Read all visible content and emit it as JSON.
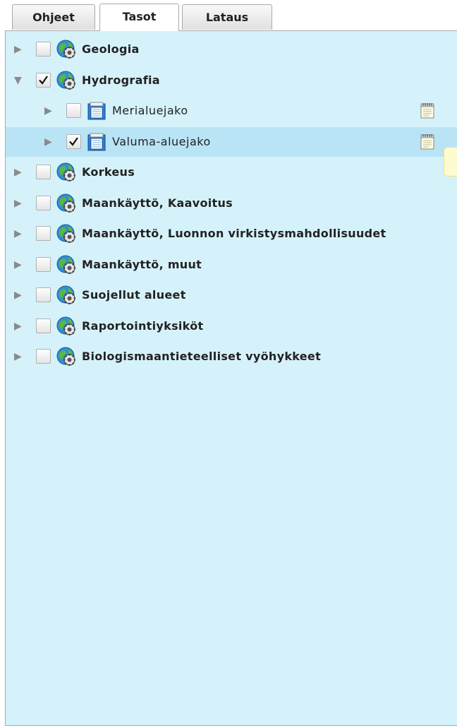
{
  "tabs": [
    {
      "label": "Ohjeet",
      "active": false
    },
    {
      "label": "Tasot",
      "active": true
    },
    {
      "label": "Lataus",
      "active": false
    }
  ],
  "layers": [
    {
      "label": "Geologia",
      "level": 0,
      "checked": false,
      "expanded": false,
      "icon": "globe-gear-icon"
    },
    {
      "label": "Hydrografia",
      "level": 0,
      "checked": true,
      "expanded": true,
      "icon": "globe-gear-icon"
    },
    {
      "label": "Merialuejako",
      "level": 1,
      "checked": false,
      "expanded": false,
      "icon": "folder-layer-icon",
      "has_metadata": true
    },
    {
      "label": "Valuma-aluejako",
      "level": 1,
      "checked": true,
      "expanded": false,
      "icon": "folder-layer-icon",
      "has_metadata": true,
      "selected": true
    },
    {
      "label": "Korkeus",
      "level": 0,
      "checked": false,
      "expanded": false,
      "icon": "globe-gear-icon"
    },
    {
      "label": "Maankäyttö, Kaavoitus",
      "level": 0,
      "checked": false,
      "expanded": false,
      "icon": "globe-gear-icon"
    },
    {
      "label": "Maankäyttö, Luonnon virkistysmahdollisuudet",
      "level": 0,
      "checked": false,
      "expanded": false,
      "icon": "globe-gear-icon"
    },
    {
      "label": "Maankäyttö, muut",
      "level": 0,
      "checked": false,
      "expanded": false,
      "icon": "globe-gear-icon"
    },
    {
      "label": "Suojellut alueet",
      "level": 0,
      "checked": false,
      "expanded": false,
      "icon": "globe-gear-icon"
    },
    {
      "label": "Raportointiyksiköt",
      "level": 0,
      "checked": false,
      "expanded": false,
      "icon": "globe-gear-icon"
    },
    {
      "label": "Biologismaantieteelliset vyöhykkeet",
      "level": 0,
      "checked": false,
      "expanded": false,
      "icon": "globe-gear-icon"
    }
  ],
  "colors": {
    "panel_background": "#d5f2fa",
    "selected_row": "#b9e4f6",
    "tooltip": "#fffbd0"
  }
}
